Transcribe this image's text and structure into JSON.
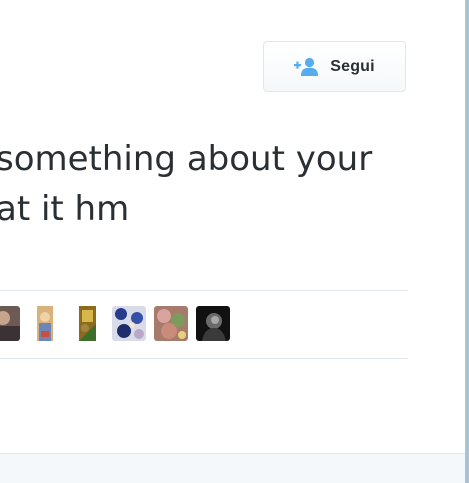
{
  "follow_button": {
    "label": "Segui",
    "icon": "add-user-icon",
    "accent_color": "#55acee"
  },
  "tweet": {
    "text_lines": [
      "something about your",
      "at it hm"
    ]
  },
  "liked_by": {
    "avatars": [
      {
        "name": "avatar-1"
      },
      {
        "name": "avatar-2"
      },
      {
        "name": "avatar-3"
      },
      {
        "name": "avatar-4"
      },
      {
        "name": "avatar-5"
      },
      {
        "name": "avatar-6"
      }
    ]
  }
}
